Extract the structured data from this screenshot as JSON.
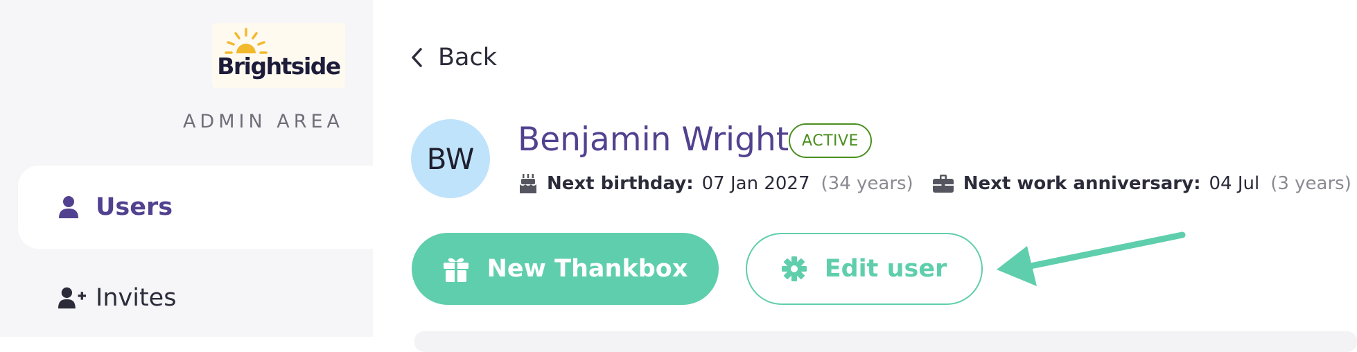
{
  "sidebar": {
    "logo_text": "Brightside",
    "section_label": "ADMIN AREA",
    "items": [
      {
        "label": "Users",
        "icon": "user-icon",
        "active": true
      },
      {
        "label": "Invites",
        "icon": "user-plus-icon",
        "active": false
      }
    ]
  },
  "header": {
    "back_label": "Back"
  },
  "user": {
    "initials": "BW",
    "name": "Benjamin Wright",
    "status": "ACTIVE",
    "birthday_label": "Next birthday:",
    "birthday_value": "07 Jan 2027",
    "birthday_age": "(34 years)",
    "anniversary_label": "Next work anniversary:",
    "anniversary_value": "04 Jul",
    "anniversary_years": "(3 years)"
  },
  "actions": {
    "new_thankbox_label": "New Thankbox",
    "edit_user_label": "Edit user"
  },
  "colors": {
    "accent": "#5fceac",
    "brand_purple": "#52418f",
    "status_green": "#4b8f1f",
    "avatar_bg": "#bfe3fb",
    "sun_yellow": "#f2b92d"
  }
}
